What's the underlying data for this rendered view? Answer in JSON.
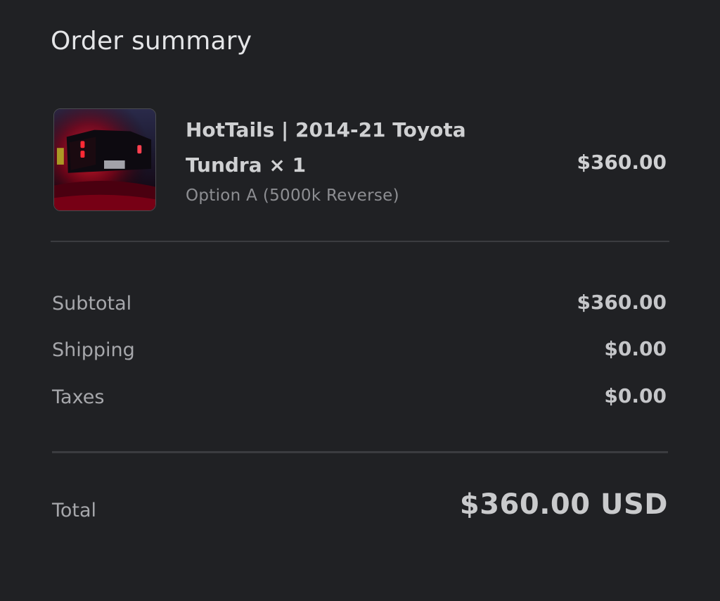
{
  "summary": {
    "title": "Order summary"
  },
  "item": {
    "image_icon": "product-photo-truck-taillights",
    "name": "HotTails | 2014-21 Toyota Tundra × 1",
    "variant": "Option A (5000k Reverse)",
    "price": "$360.00"
  },
  "totals": {
    "subtotal_label": "Subtotal",
    "subtotal_value": "$360.00",
    "shipping_label": "Shipping",
    "shipping_value": "$0.00",
    "taxes_label": "Taxes",
    "taxes_value": "$0.00",
    "total_label": "Total",
    "total_value": "$360.00 USD"
  },
  "colors": {
    "background": "#202124",
    "divider": "#3b3c40",
    "primary_text": "#cfd0d2",
    "secondary_text": "#8d8e92"
  }
}
